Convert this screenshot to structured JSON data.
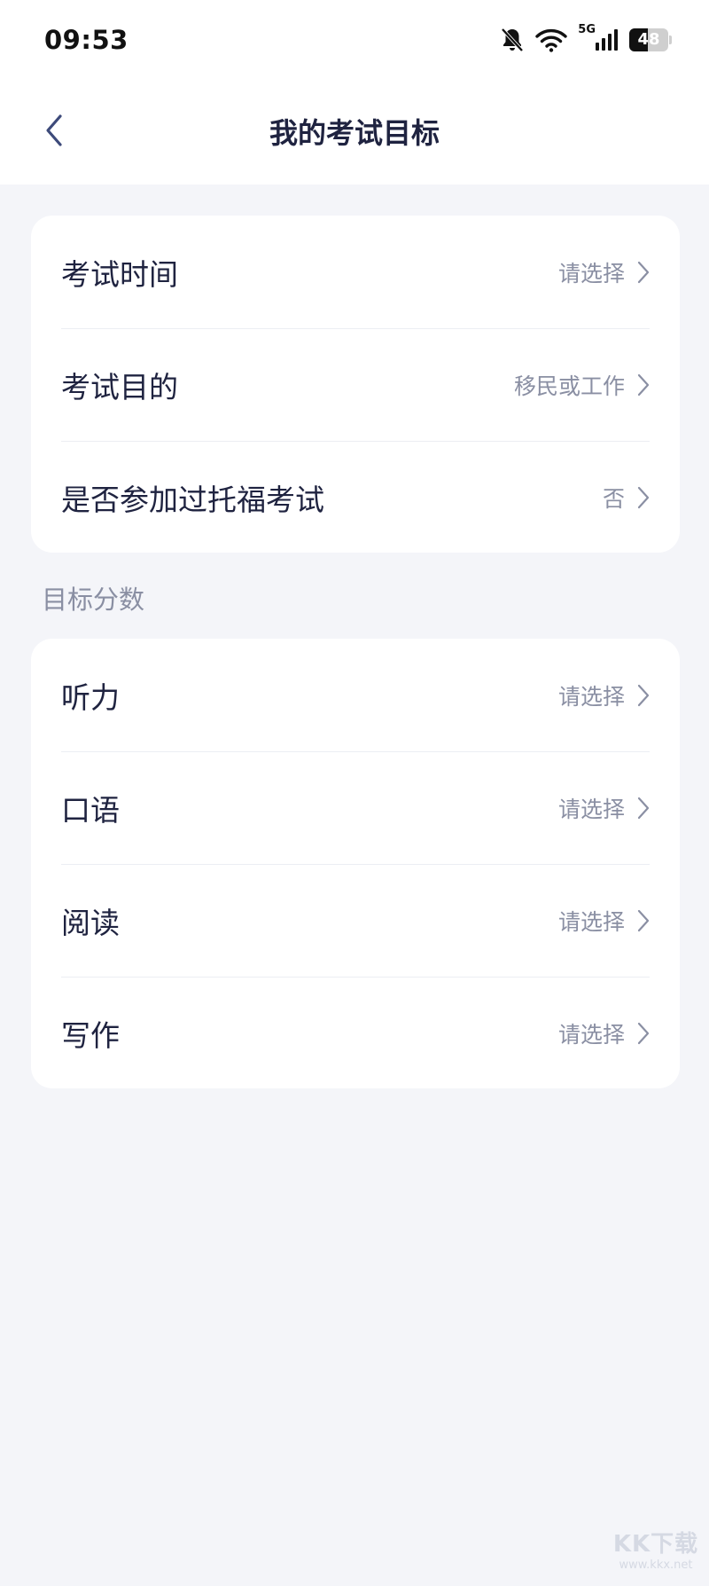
{
  "status_bar": {
    "time": "09:53",
    "network": "5G",
    "battery": 48,
    "icons": [
      "bell-off-icon",
      "wifi-icon",
      "signal-icon",
      "battery-icon"
    ]
  },
  "header": {
    "title": "我的考试目标",
    "back_icon": "chevron-left-icon"
  },
  "exam_info": {
    "items": [
      {
        "label": "考试时间",
        "value": "请选择"
      },
      {
        "label": "考试目的",
        "value": "移民或工作"
      },
      {
        "label": "是否参加过托福考试",
        "value": "否"
      }
    ]
  },
  "target_score": {
    "section_title": "目标分数",
    "items": [
      {
        "label": "听力",
        "value": "请选择"
      },
      {
        "label": "口语",
        "value": "请选择"
      },
      {
        "label": "阅读",
        "value": "请选择"
      },
      {
        "label": "写作",
        "value": "请选择"
      }
    ]
  },
  "watermark": {
    "main": "KK下载",
    "sub": "www.kkx.net"
  },
  "colors": {
    "background": "#f4f5f9",
    "title_text": "#1f2340",
    "secondary_text": "#8a8fa3"
  }
}
